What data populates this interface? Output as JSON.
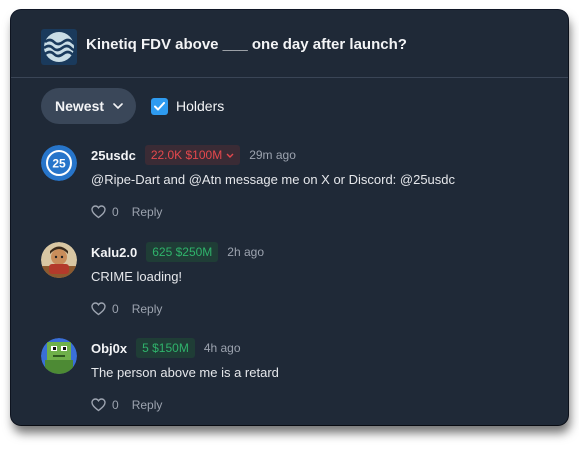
{
  "market": {
    "title": "Kinetiq FDV above ___ one day after launch?",
    "icon": "kinetiq-wave-logo"
  },
  "controls": {
    "sort_label": "Newest",
    "holders_label": "Holders",
    "holders_checked": true
  },
  "colors": {
    "panel_bg": "#1f2937",
    "accent_blue": "#2e9bf0",
    "red": "#e5484d",
    "green": "#2fb36b"
  },
  "comments": [
    {
      "username": "25usdc",
      "badge": "22.0K $100M",
      "badge_color": "red",
      "badge_has_dropdown": true,
      "time": "29m ago",
      "text": "@Ripe-Dart and @Atn message me on X or Discord: @25usdc",
      "likes": "0",
      "reply_label": "Reply",
      "avatar": "usdc-coin-avatar"
    },
    {
      "username": "Kalu2.0",
      "badge": "625 $250M",
      "badge_color": "green",
      "badge_has_dropdown": false,
      "time": "2h ago",
      "text": "CRIME loading!",
      "likes": "0",
      "reply_label": "Reply",
      "avatar": "character-avatar"
    },
    {
      "username": "Obj0x",
      "badge": "5 $150M",
      "badge_color": "green",
      "badge_has_dropdown": false,
      "time": "4h ago",
      "text": "The person above me is a retard",
      "likes": "0",
      "reply_label": "Reply",
      "avatar": "pixel-frog-avatar"
    }
  ]
}
